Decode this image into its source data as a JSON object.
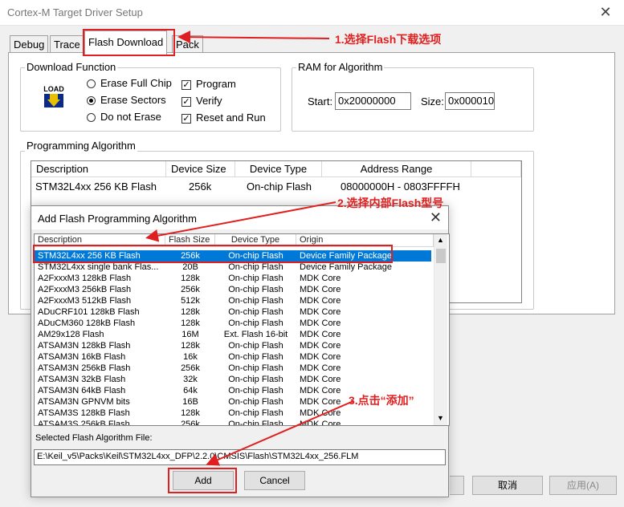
{
  "window": {
    "title": "Cortex-M Target Driver Setup",
    "close": "✕"
  },
  "tabs": [
    "Debug",
    "Trace",
    "Flash Download",
    "Pack"
  ],
  "download_function": {
    "label": "Download Function",
    "icon_text": "LOAD",
    "radios": [
      {
        "label": "Erase Full Chip",
        "checked": false
      },
      {
        "label": "Erase Sectors",
        "checked": true
      },
      {
        "label": "Do not Erase",
        "checked": false
      }
    ],
    "checks": [
      {
        "label": "Program",
        "checked": true
      },
      {
        "label": "Verify",
        "checked": true
      },
      {
        "label": "Reset and Run",
        "checked": true
      }
    ]
  },
  "ram": {
    "label": "RAM for Algorithm",
    "start_label": "Start:",
    "start_value": "0x20000000",
    "size_label": "Size:",
    "size_value": "0x000010"
  },
  "programming": {
    "label": "Programming Algorithm",
    "headers": [
      "Description",
      "Device Size",
      "Device Type",
      "Address Range"
    ],
    "row": [
      "STM32L4xx 256 KB Flash",
      "256k",
      "On-chip Flash",
      "08000000H - 0803FFFFH"
    ]
  },
  "dialog": {
    "title": "Add Flash Programming Algorithm",
    "close": "✕",
    "headers": [
      "Description",
      "Flash Size",
      "Device Type",
      "Origin"
    ],
    "rows": [
      [
        "STM32L4xx 256 KB Flash",
        "256k",
        "On-chip Flash",
        "Device Family Package"
      ],
      [
        "STM32L4xx single bank Flas...",
        "20B",
        "On-chip Flash",
        "Device Family Package"
      ],
      [
        "A2FxxxM3 128kB Flash",
        "128k",
        "On-chip Flash",
        "MDK Core"
      ],
      [
        "A2FxxxM3 256kB Flash",
        "256k",
        "On-chip Flash",
        "MDK Core"
      ],
      [
        "A2FxxxM3 512kB Flash",
        "512k",
        "On-chip Flash",
        "MDK Core"
      ],
      [
        "ADuCRF101 128kB Flash",
        "128k",
        "On-chip Flash",
        "MDK Core"
      ],
      [
        "ADuCM360 128kB Flash",
        "128k",
        "On-chip Flash",
        "MDK Core"
      ],
      [
        "AM29x128 Flash",
        "16M",
        "Ext. Flash 16-bit",
        "MDK Core"
      ],
      [
        "ATSAM3N 128kB Flash",
        "128k",
        "On-chip Flash",
        "MDK Core"
      ],
      [
        "ATSAM3N 16kB Flash",
        "16k",
        "On-chip Flash",
        "MDK Core"
      ],
      [
        "ATSAM3N 256kB Flash",
        "256k",
        "On-chip Flash",
        "MDK Core"
      ],
      [
        "ATSAM3N 32kB Flash",
        "32k",
        "On-chip Flash",
        "MDK Core"
      ],
      [
        "ATSAM3N 64kB Flash",
        "64k",
        "On-chip Flash",
        "MDK Core"
      ],
      [
        "ATSAM3N GPNVM bits",
        "16B",
        "On-chip Flash",
        "MDK Core"
      ],
      [
        "ATSAM3S 128kB Flash",
        "128k",
        "On-chip Flash",
        "MDK Core"
      ],
      [
        "ATSAM3S 256kB Flash",
        "256k",
        "On-chip Flash",
        "MDK Core"
      ]
    ],
    "selected_label": "Selected Flash Algorithm File:",
    "selected_path": "E:\\Keil_v5\\Packs\\Keil\\STM32L4xx_DFP\\2.2.0\\CMSIS\\Flash\\STM32L4xx_256.FLM",
    "add_button": "Add",
    "cancel_button": "Cancel"
  },
  "bottom_buttons": {
    "cancel": "取消",
    "apply": "应用(A)"
  },
  "annotations": {
    "step1": "1.选择Flash下载选项",
    "step2": "2.选择内部Flash型号",
    "step3": "3.点击“添加”"
  },
  "colors": {
    "annotation": "#e02020",
    "selection": "#0078d7"
  }
}
